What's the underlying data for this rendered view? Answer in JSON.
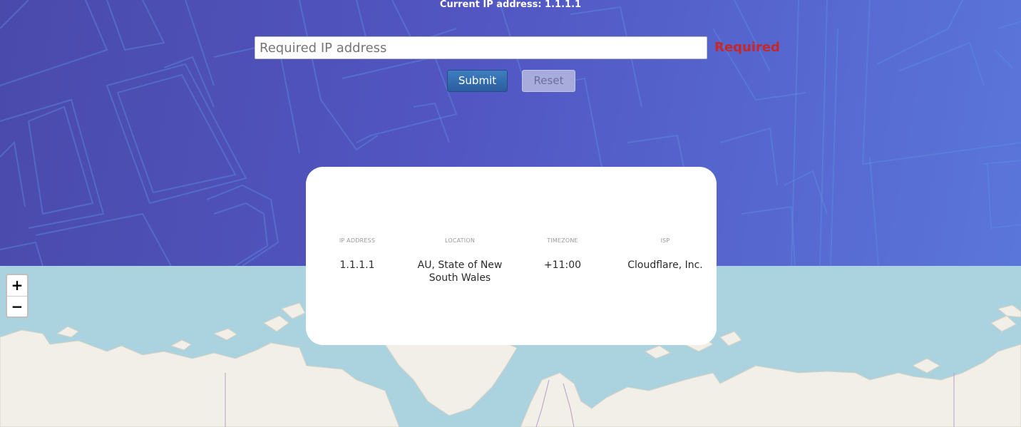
{
  "header": {
    "title": "Current IP address: 1.1.1.1",
    "input_placeholder": "Required IP address",
    "required_message": "Required",
    "submit_label": "Submit",
    "reset_label": "Reset"
  },
  "info": {
    "columns": [
      {
        "label": "IP ADDRESS",
        "value": "1.1.1.1"
      },
      {
        "label": "LOCATION",
        "value": "AU, State of New South Wales"
      },
      {
        "label": "TIMEZONE",
        "value": "+11:00"
      },
      {
        "label": "ISP",
        "value": "Cloudflare, Inc."
      }
    ]
  },
  "map": {
    "zoom_in_label": "+",
    "zoom_out_label": "−"
  },
  "colors": {
    "header_gradient_start": "#4a4aab",
    "header_gradient_end": "#5a76db",
    "submit_bg": "#2b5d9c",
    "required_text": "#c62828",
    "water": "#aad3df",
    "land": "#f2efe9"
  }
}
